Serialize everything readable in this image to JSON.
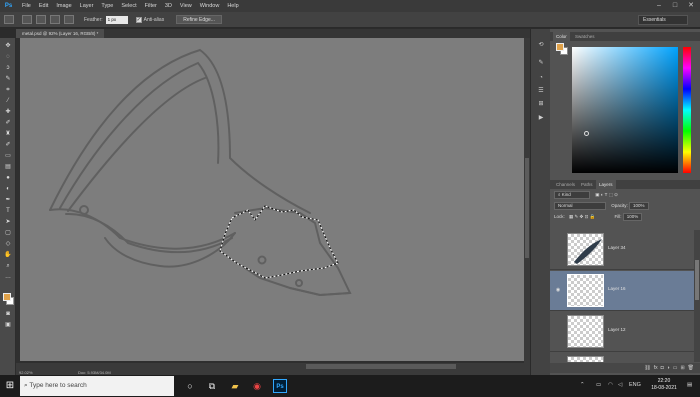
{
  "menubar": {
    "logo": "Ps",
    "items": [
      "File",
      "Edit",
      "Image",
      "Layer",
      "Type",
      "Select",
      "Filter",
      "3D",
      "View",
      "Window",
      "Help"
    ],
    "minimize": "–",
    "maximize": "□",
    "close": "✕"
  },
  "options": {
    "feather_label": "Feather:",
    "feather_value": "1 px",
    "antialias_label": "Anti-alias",
    "antialias_checked": "✓",
    "refine_edge": "Refine Edge...",
    "workspace": "Essentials"
  },
  "document": {
    "tab_title": "metal.psd @ 92% (Layer 16, RGB/8) *",
    "zoom": "92.02%",
    "doc_size": "Doc: 5.93M/34.0M"
  },
  "color_panel": {
    "tabs": [
      "Color",
      "Swatches"
    ],
    "foreground": "#e0a24a",
    "background": "#ffffff"
  },
  "layers_panel": {
    "tabs": [
      "Channels",
      "Paths",
      "Layers"
    ],
    "filter_kind": "Kind",
    "blend_mode": "Normal",
    "opacity_label": "Opacity:",
    "opacity_value": "100%",
    "lock_label": "Lock:",
    "fill_label": "Fill:",
    "fill_value": "100%",
    "layers": [
      {
        "name": "Layer 34",
        "selected": false,
        "visible": false
      },
      {
        "name": "Layer 16",
        "selected": true,
        "visible": true
      },
      {
        "name": "Layer 12",
        "selected": false,
        "visible": false
      }
    ]
  },
  "taskbar": {
    "search_placeholder": "Type here to search",
    "language": "ENG",
    "time": "22:20",
    "date": "18-08-2021"
  }
}
